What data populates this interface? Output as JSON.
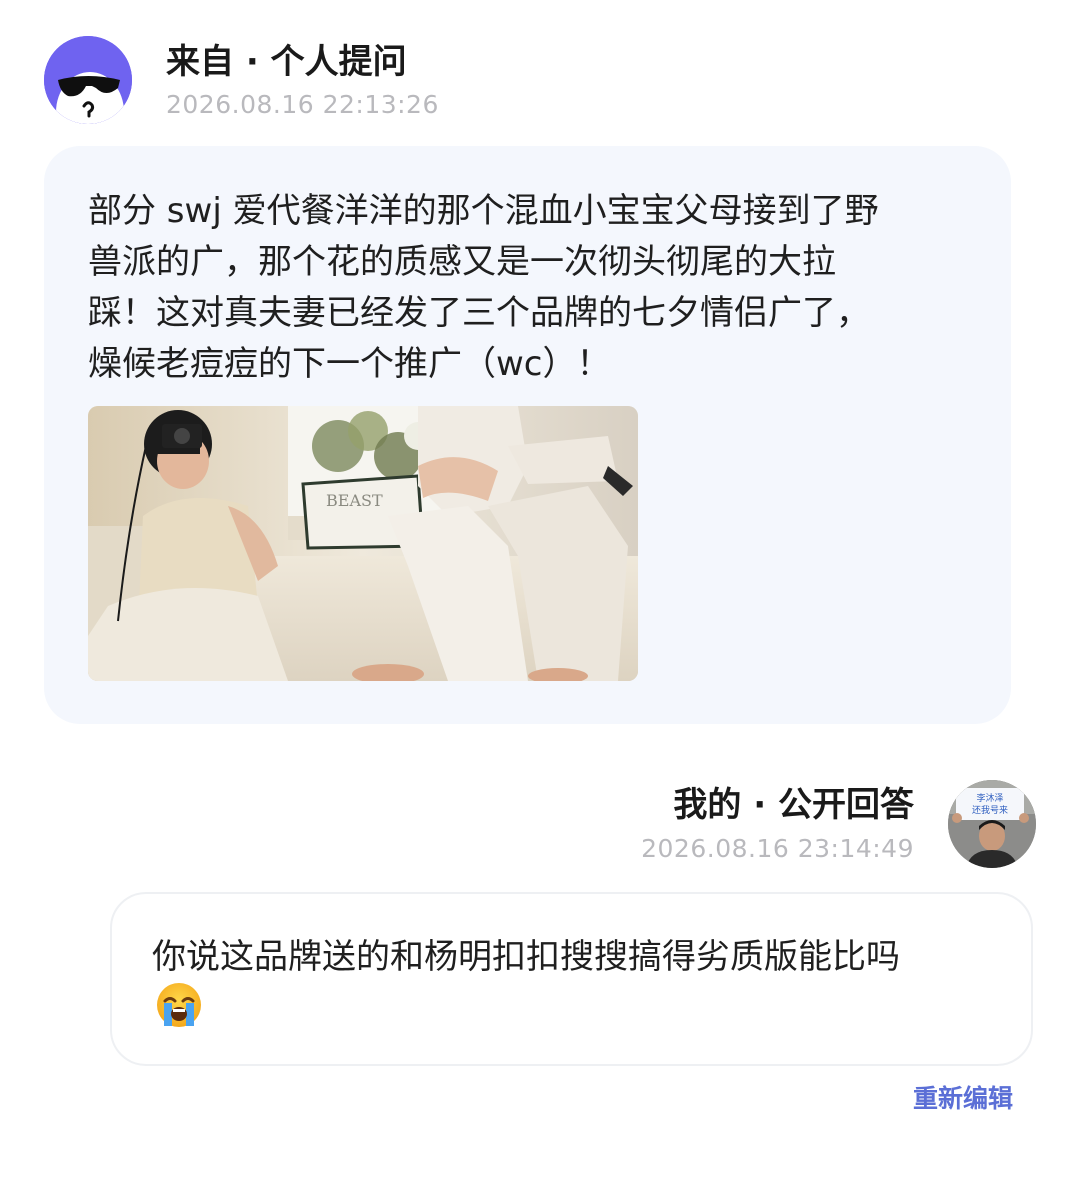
{
  "question": {
    "source_label": "来自 · 个人提问",
    "timestamp": "2026.08.16 22:13:26",
    "text": "部分 swj 爱代餐洋洋的那个混血小宝宝父母接到了野\n兽派的广，那个花的质感又是一次彻头彻尾的大拉\n踩！这对真夫妻已经发了三个品牌的七夕情侣广了，\n燥候老痘痘的下一个推广（wc）！",
    "photo_text": "BEAST",
    "avatar_icon": "sunglasses-face-icon",
    "avatar_bg": "#6f63f0"
  },
  "answer": {
    "source_label": "我的 · 公开回答",
    "timestamp": "2026.08.16 23:14:49",
    "text": "你说这品牌送的和杨明扣扣搜搜搞得劣质版能比吗",
    "emoji_icon": "loudly-crying-face-icon",
    "edit_label": "重新编辑",
    "avatar_sign_line1": "李沐泽",
    "avatar_sign_line2": "还我号来"
  },
  "colors": {
    "bubble_bg": "#f4f7fd",
    "link": "#5b6fd6",
    "meta_text": "#b9b9bd"
  }
}
